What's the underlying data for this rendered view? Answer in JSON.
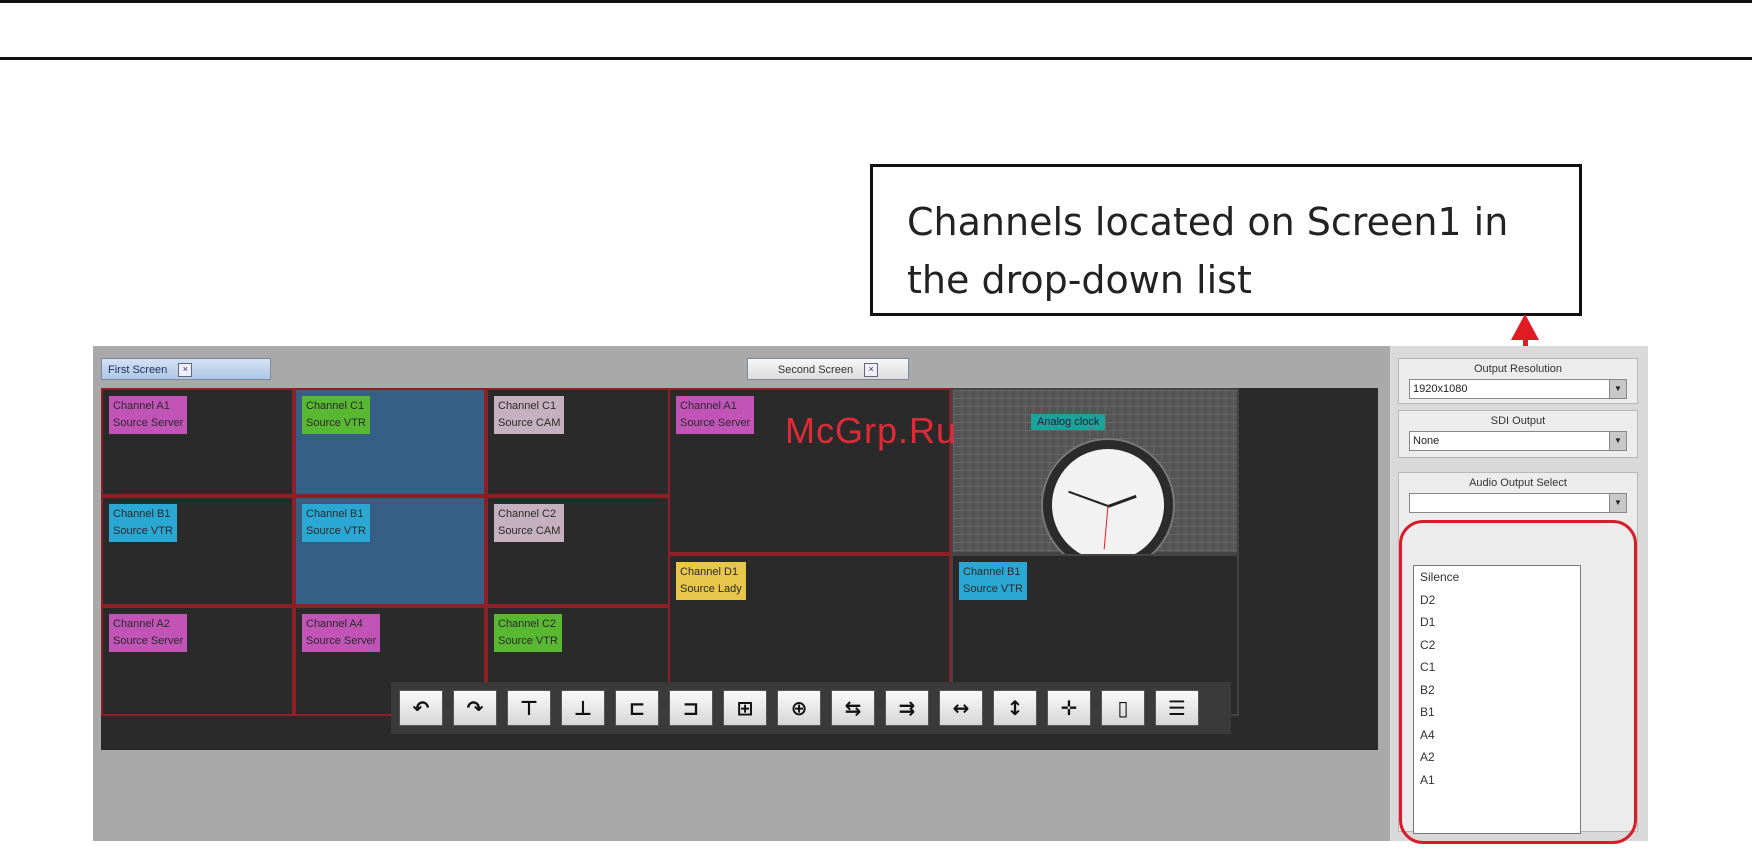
{
  "callout": {
    "line1": "Channels located on Screen1 in",
    "line2": "the drop-down list"
  },
  "watermark": "McGrp.Ru",
  "tabs": {
    "first": "First Screen",
    "second": "Second Screen",
    "close_glyph": "×"
  },
  "screen1": {
    "cells": [
      {
        "channel": "Channel A1",
        "source": "Source Server",
        "color": "#c254b8"
      },
      {
        "channel": "Channel C1",
        "source": "Source VTR",
        "color": "#59b832"
      },
      {
        "channel": "Channel C1",
        "source": "Source CAM",
        "color": "#c4b0be"
      },
      {
        "channel": "Channel B1",
        "source": "Source VTR",
        "color": "#2aa7d3"
      },
      {
        "channel": "Channel B1",
        "source": "Source VTR",
        "color": "#2aa7d3"
      },
      {
        "channel": "Channel C2",
        "source": "Source CAM",
        "color": "#c4b0be"
      },
      {
        "channel": "Channel A2",
        "source": "Source Server",
        "color": "#c254b8"
      },
      {
        "channel": "Channel A4",
        "source": "Source Server",
        "color": "#c254b8"
      },
      {
        "channel": "Channel C2",
        "source": "Source VTR",
        "color": "#59b832"
      }
    ]
  },
  "screen2": {
    "cells": [
      {
        "channel": "Channel A1",
        "source": "Source Server",
        "color": "#c254b8"
      },
      {
        "channel": "Channel D1",
        "source": "Source Lady",
        "color": "#e8c64a"
      },
      {
        "channel": "Channel B1",
        "source": "Source VTR",
        "color": "#2aa7d3"
      }
    ],
    "clock_label": "Analog clock"
  },
  "toolbar": {
    "buttons": [
      {
        "name": "undo-button",
        "glyph": "↶"
      },
      {
        "name": "redo-button",
        "glyph": "↷"
      },
      {
        "name": "align-top-button",
        "glyph": "⊤"
      },
      {
        "name": "align-bottom-button",
        "glyph": "⊥"
      },
      {
        "name": "align-left-button",
        "glyph": "⊏"
      },
      {
        "name": "align-right-button",
        "glyph": "⊐"
      },
      {
        "name": "center-horizontal-button",
        "glyph": "⊞"
      },
      {
        "name": "center-vertical-button",
        "glyph": "⊕"
      },
      {
        "name": "distribute-button",
        "glyph": "⇆"
      },
      {
        "name": "space-evenly-button",
        "glyph": "⇉"
      },
      {
        "name": "stretch-width-button",
        "glyph": "↔"
      },
      {
        "name": "stretch-height-button",
        "glyph": "↕"
      },
      {
        "name": "move-button",
        "glyph": "✛"
      },
      {
        "name": "split-columns-button",
        "glyph": "▯"
      },
      {
        "name": "split-rows-button",
        "glyph": "☰"
      }
    ]
  },
  "panel": {
    "output_resolution_title": "Output Resolution",
    "output_resolution_value": "1920x1080",
    "sdi_output_title": "SDI Output",
    "sdi_output_value": "None",
    "audio_output_title": "Audio Output Select",
    "audio_output_value": "",
    "dropdown_arrow": "▼",
    "audio_options": [
      "Silence",
      "D2",
      "D1",
      "C2",
      "C1",
      "B2",
      "B1",
      "A4",
      "A2",
      "A1"
    ]
  },
  "colors": {
    "highlight_red": "#d81d2a",
    "app_background": "#a9a9a9",
    "screen_border": "#8e1f26"
  }
}
